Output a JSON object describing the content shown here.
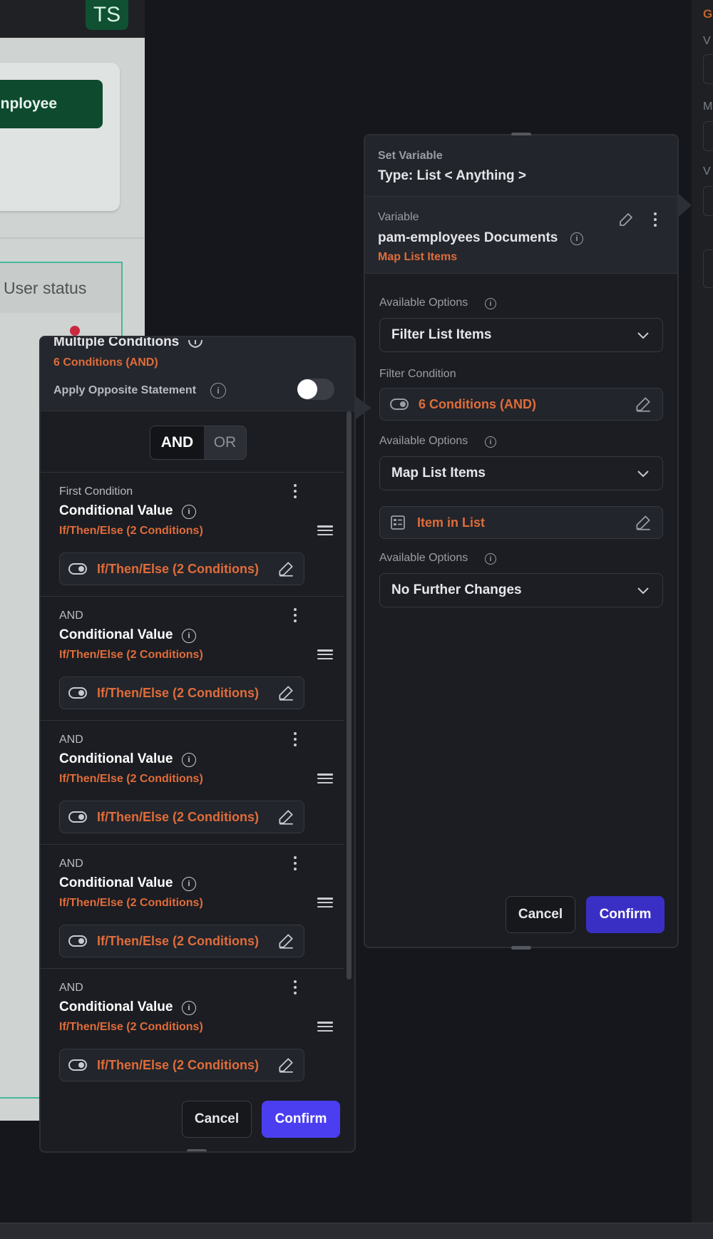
{
  "background": {
    "avatar_initials": "TS",
    "employee_button_label": "nployee",
    "user_status_header": "User status",
    "right_strip": {
      "g_label": "G",
      "v1": "V",
      "m": "M",
      "v2": "V"
    }
  },
  "set_variable_panel": {
    "header_label": "Set Variable",
    "type_label": "Type: List < Anything >",
    "variable_label": "Variable",
    "variable_name": "pam-employees Documents",
    "variable_sub": "Map List Items",
    "options_1_label": "Available Options",
    "options_1_value": "Filter List Items",
    "filter_condition_label": "Filter Condition",
    "filter_condition_value": "6 Conditions (AND)",
    "options_2_label": "Available Options",
    "options_2_value": "Map List Items",
    "item_field_value": "Item in List",
    "options_3_label": "Available Options",
    "options_3_value": "No Further Changes",
    "cancel_label": "Cancel",
    "confirm_label": "Confirm"
  },
  "conditions_panel": {
    "title": "Multiple Conditions",
    "subtitle": "6 Conditions (AND)",
    "opposite_label": "Apply Opposite Statement",
    "toggle_on": false,
    "logic": {
      "and_label": "AND",
      "or_label": "OR",
      "selected": "AND"
    },
    "conditions": [
      {
        "prefix": "First Condition",
        "title": "Conditional Value",
        "subtitle": "If/Then/Else (2 Conditions)",
        "field": "If/Then/Else (2 Conditions)"
      },
      {
        "prefix": "AND",
        "title": "Conditional Value",
        "subtitle": "If/Then/Else (2 Conditions)",
        "field": "If/Then/Else (2 Conditions)"
      },
      {
        "prefix": "AND",
        "title": "Conditional Value",
        "subtitle": "If/Then/Else (2 Conditions)",
        "field": "If/Then/Else (2 Conditions)"
      },
      {
        "prefix": "AND",
        "title": "Conditional Value",
        "subtitle": "If/Then/Else (2 Conditions)",
        "field": "If/Then/Else (2 Conditions)"
      },
      {
        "prefix": "AND",
        "title": "Conditional Value",
        "subtitle": "If/Then/Else (2 Conditions)",
        "field": "If/Then/Else (2 Conditions)"
      }
    ],
    "cancel_label": "Cancel",
    "confirm_label": "Confirm"
  },
  "colors": {
    "accent_orange": "#e06c3a",
    "confirm_primary": "#4b3ef0",
    "confirm_secondary": "#3a2fc4",
    "brand_green": "#0d4a2e"
  }
}
